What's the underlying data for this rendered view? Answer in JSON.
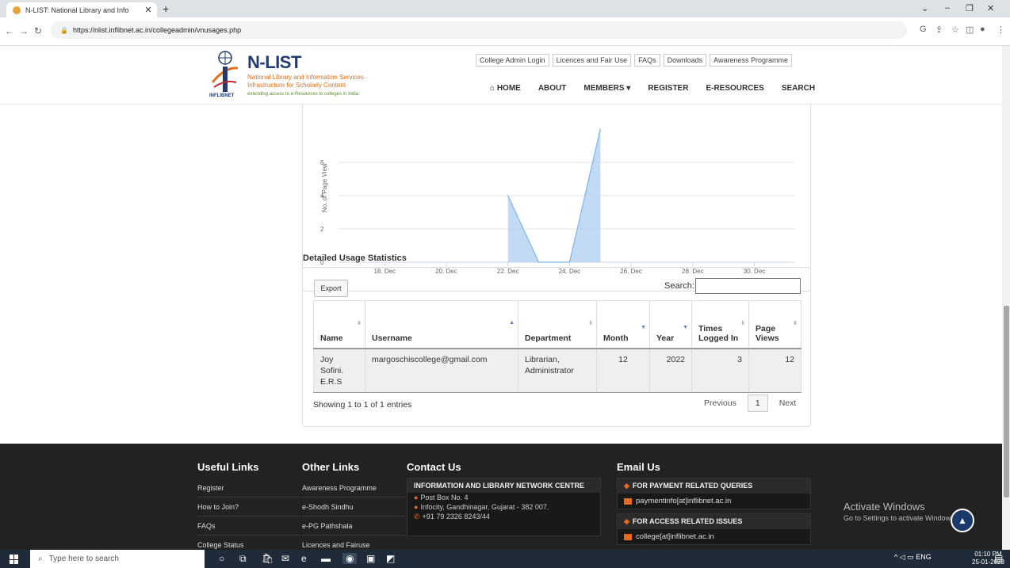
{
  "browser": {
    "tab_title": "N-LIST: National Library and Info",
    "url": "https://nlist.inflibnet.ac.in/collegeadmin/vnusages.php"
  },
  "header": {
    "logo_title": "N-LIST",
    "logo_line1": "National Library and Information Services",
    "logo_line2": "Infrastructure for Scholarly Content",
    "logo_tagline": "extending access to e-Resources to colleges in India",
    "logo_org": "INFLIBNET",
    "top_links": [
      "College Admin Login",
      "Licences and Fair Use",
      "FAQs",
      "Downloads",
      "Awareness Programme"
    ],
    "nav": {
      "home": "HOME",
      "about": "ABOUT",
      "members": "MEMBERS",
      "register": "REGISTER",
      "eresources": "E-RESOURCES",
      "search": "SEARCH"
    }
  },
  "chart_data": {
    "type": "area",
    "ylabel": "No. of Page View",
    "y_ticks": [
      0,
      2,
      4,
      6
    ],
    "x_ticks": [
      "18. Dec",
      "20. Dec",
      "22. Dec",
      "24. Dec",
      "26. Dec",
      "28. Dec",
      "30. Dec"
    ],
    "x_day_range": [
      16.5,
      31.3
    ],
    "y_range": [
      0,
      7.1
    ],
    "points": [
      {
        "day": 22,
        "y": 4
      },
      {
        "day": 23,
        "y": 0
      },
      {
        "day": 24,
        "y": 0
      },
      {
        "day": 25,
        "y": 8
      }
    ],
    "fill_color": "#aecdf0",
    "line_color": "#7cb5ec"
  },
  "usage": {
    "heading": "Detailed Usage Statistics",
    "export_label": "Export",
    "search_label": "Search:",
    "columns": [
      "Name",
      "Username",
      "Department",
      "Month",
      "Year",
      "Times Logged In",
      "Page Views"
    ],
    "rows": [
      {
        "name": "Joy Sofini. E.R.S",
        "username": "margoschiscollege@gmail.com",
        "department": "Librarian, Administrator",
        "month": "12",
        "year": "2022",
        "times_logged_in": "3",
        "page_views": "12"
      }
    ],
    "showing": "Showing 1 to 1 of 1 entries",
    "prev": "Previous",
    "page": "1",
    "next": "Next"
  },
  "footer": {
    "useful_links_title": "Useful Links",
    "useful_links": [
      "Register",
      "How to Join?",
      "FAQs",
      "College Status"
    ],
    "other_links_title": "Other Links",
    "other_links": [
      "Awareness Programme",
      "e-Shodh Sindhu",
      "e-PG Pathshala",
      "Licences and Fairuse"
    ],
    "contact_title": "Contact Us",
    "contact_org": "INFORMATION AND LIBRARY NETWORK CENTRE",
    "contact_addr1": "Post Box No. 4",
    "contact_addr2": "Infocity, Gandhinagar, Gujarat - 382 007.",
    "contact_phone": "+91 79 2326 8243/44",
    "email_title": "Email Us",
    "payment_heading": "FOR PAYMENT RELATED QUERIES",
    "payment_email": "paymentinfo[at]inflibnet.ac.in",
    "access_heading": "FOR ACCESS RELATED ISSUES",
    "access_email": "college[at]inflibnet.ac.in"
  },
  "windows": {
    "activate_title": "Activate Windows",
    "activate_sub": "Go to Settings to activate Windows.",
    "search_placeholder": "Type here to search",
    "lang": "ENG",
    "time": "01:10 PM",
    "date": "25-01-2023"
  }
}
